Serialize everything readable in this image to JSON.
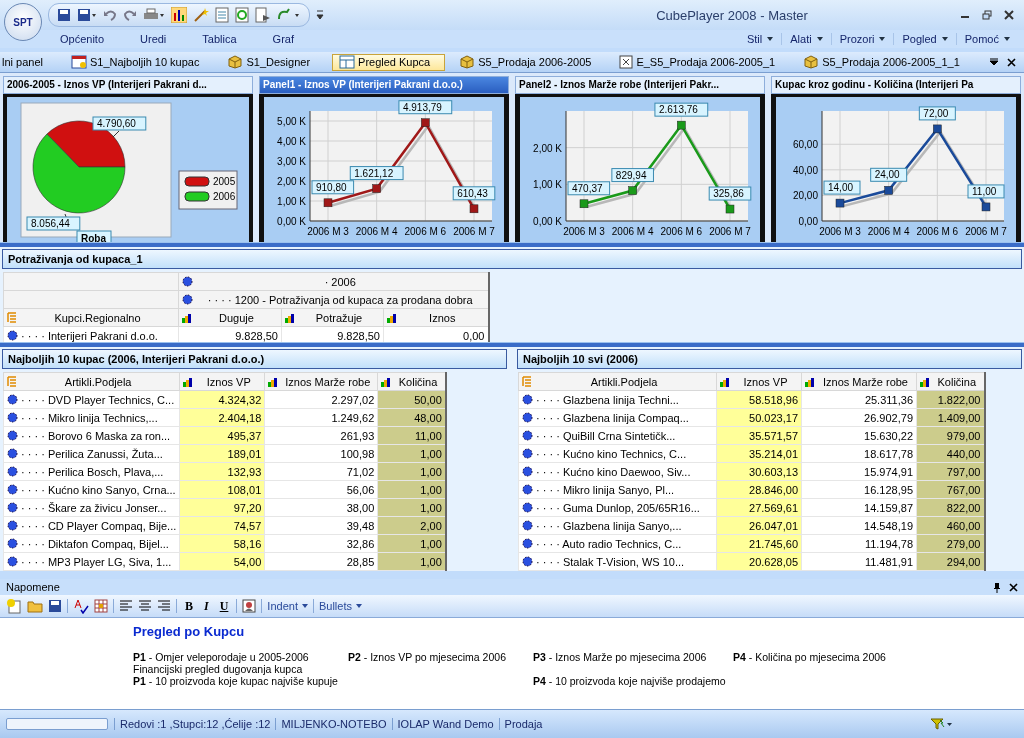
{
  "window": {
    "title": "CubePlayer 2008 - Master",
    "logo": "SPT"
  },
  "menu_left": [
    "Općenito",
    "Uredi",
    "Tablica",
    "Graf"
  ],
  "menu_right": [
    "Stil",
    "Alati",
    "Prozori",
    "Pogled",
    "Pomoć"
  ],
  "tabs": [
    {
      "label": "lni panel",
      "kind": "plain",
      "selected": false
    },
    {
      "label": "S1_Najboljih 10 kupac",
      "kind": "report",
      "selected": false
    },
    {
      "label": "S1_Designer",
      "kind": "cube",
      "selected": false
    },
    {
      "label": "Pregled Kupca",
      "kind": "layout",
      "selected": true
    },
    {
      "label": "S5_Prodaja 2006-2005",
      "kind": "cube",
      "selected": false
    },
    {
      "label": "E_S5_Prodaja 2006-2005_1",
      "kind": "script",
      "selected": false
    },
    {
      "label": "S5_Prodaja 2006-2005_1_1",
      "kind": "cube",
      "selected": false
    }
  ],
  "chart_panels": [
    {
      "title": "2006-2005 - Iznos VP (Interijeri Pakrani d...",
      "selected": false,
      "chart_data": {
        "type": "pie",
        "title": "Roba",
        "categories": [
          "2005",
          "2006"
        ],
        "values": [
          4790.6,
          8056.44
        ],
        "legend": true,
        "value_labels": [
          "4.790,60",
          "8.056,44"
        ]
      }
    },
    {
      "title": "Panel1 - Iznos VP (Interijeri Pakrani d.o.o.)",
      "selected": true,
      "chart_data": {
        "type": "line",
        "categories": [
          "2006 M 3",
          "2006 M 4",
          "2006 M 6",
          "2006 M 7"
        ],
        "grid": true,
        "series": [
          {
            "color": "#a01818",
            "marker": "square",
            "values": [
              911,
              1621,
              4914,
              610
            ]
          }
        ],
        "ylim": [
          0,
          5500
        ],
        "yticks": [
          {
            "value": 0,
            "label": "0,00 K"
          },
          {
            "value": 1000,
            "label": "1,00 K"
          },
          {
            "value": 2000,
            "label": "2,00 K"
          },
          {
            "value": 3000,
            "label": "3,00 K"
          },
          {
            "value": 4000,
            "label": "4,00 K"
          },
          {
            "value": 5000,
            "label": "5,00 K"
          }
        ],
        "value_labels": [
          "910,80",
          "1.621,12",
          "4.913,79",
          "610,43"
        ]
      }
    },
    {
      "title": "Panel2 - Iznos Marže robe (Interijeri Pakr...",
      "selected": false,
      "chart_data": {
        "type": "line",
        "categories": [
          "2006 M 3",
          "2006 M 4",
          "2006 M 6",
          "2006 M 7"
        ],
        "grid": true,
        "series": [
          {
            "color": "#1a9a1a",
            "marker": "square",
            "values": [
              470,
              830,
              2614,
              326
            ]
          }
        ],
        "ylim": [
          0,
          3000
        ],
        "yticks": [
          {
            "value": 0,
            "label": "0,00 K"
          },
          {
            "value": 1000,
            "label": "1,00 K"
          },
          {
            "value": 2000,
            "label": "2,00 K"
          }
        ],
        "value_labels": [
          "470,37",
          "829,94",
          "2.613,76",
          "325,86"
        ]
      }
    },
    {
      "title": "Kupac kroz godinu - Količina (Interijeri Pa",
      "selected": false,
      "chart_data": {
        "type": "line",
        "categories": [
          "2006 M 3",
          "2006 M 4",
          "2006 M 6",
          "2006 M 7"
        ],
        "grid": true,
        "series": [
          {
            "color": "#1a4a9a",
            "marker": "square",
            "values": [
              14,
              24,
              72,
              11
            ]
          }
        ],
        "ylim": [
          0,
          86
        ],
        "yticks": [
          {
            "value": 0,
            "label": "0,00"
          },
          {
            "value": 20,
            "label": "20,00"
          },
          {
            "value": 40,
            "label": "40,00"
          },
          {
            "value": 60,
            "label": "60,00"
          }
        ],
        "value_labels": [
          "14,00",
          "24,00",
          "72,00",
          "11,00"
        ]
      }
    }
  ],
  "receivables": {
    "title": "Potraživanja od kupaca_1",
    "column_levels": [
      "· 2006",
      "· · · · 1200 - Potraživanja od kupaca za prodana dobra"
    ],
    "row_header": "Kupci.Regionalno",
    "columns": [
      "Duguje",
      "Potražuje",
      "Iznos"
    ],
    "rows": [
      {
        "label": "· · · · Interijeri Pakrani d.o.o.",
        "cells": [
          "9.828,50",
          "9.828,50",
          "0,00"
        ]
      }
    ]
  },
  "tables": [
    {
      "title": "Najboljih 10 kupac (2006, Interijeri Pakrani d.o.o.)",
      "row_header": "Artikli.Podjela",
      "columns": [
        {
          "label": "Iznos VP",
          "color": "#ffff99"
        },
        {
          "label": "Iznos Marže robe",
          "color": "#ffffff"
        },
        {
          "label": "Količina",
          "color": "#cccc8c"
        }
      ],
      "rows": [
        {
          "label": "· · · · DVD Player Technics, C...",
          "cells": [
            "4.324,32",
            "2.297,02",
            "50,00"
          ]
        },
        {
          "label": "· · · · Mikro linija Technics,...",
          "cells": [
            "2.404,18",
            "1.249,62",
            "48,00"
          ]
        },
        {
          "label": "· · · ·  Borovo 6 Maska za ron...",
          "cells": [
            "495,37",
            "261,93",
            "11,00"
          ]
        },
        {
          "label": "· · · · Perilica Zanussi, Žuta...",
          "cells": [
            "189,01",
            "100,98",
            "1,00"
          ]
        },
        {
          "label": "· · · · Perilica Bosch, Plava,...",
          "cells": [
            "132,93",
            "71,02",
            "1,00"
          ]
        },
        {
          "label": "· · · · Kućno kino Sanyo, Crna...",
          "cells": [
            "108,01",
            "56,06",
            "1,00"
          ]
        },
        {
          "label": "· · · · Škare za živicu Jonser...",
          "cells": [
            "97,20",
            "38,00",
            "1,00"
          ]
        },
        {
          "label": "· · · · CD Player Compaq, Bije...",
          "cells": [
            "74,57",
            "39,48",
            "2,00"
          ]
        },
        {
          "label": "· · · · Diktafon Compaq, Bijel...",
          "cells": [
            "58,16",
            "32,86",
            "1,00"
          ]
        },
        {
          "label": "· · · · MP3 Player LG, Siva, 1...",
          "cells": [
            "54,00",
            "28,85",
            "1,00"
          ]
        }
      ]
    },
    {
      "title": "Najboljih 10 svi (2006)",
      "row_header": "Artikli.Podjela",
      "columns": [
        {
          "label": "Iznos VP",
          "color": "#ffff99"
        },
        {
          "label": "Iznos Marže robe",
          "color": "#ffffff"
        },
        {
          "label": "Količina",
          "color": "#cccc8c"
        }
      ],
      "rows": [
        {
          "label": "· · · · Glazbena linija Techni...",
          "cells": [
            "58.518,96",
            "25.311,36",
            "1.822,00"
          ]
        },
        {
          "label": "· · · · Glazbena linija Compaq...",
          "cells": [
            "50.023,17",
            "26.902,79",
            "1.409,00"
          ]
        },
        {
          "label": "· · · · QuiBill Crna Sintetičk...",
          "cells": [
            "35.571,57",
            "15.630,22",
            "979,00"
          ]
        },
        {
          "label": "· · · · Kućno kino Technics, C...",
          "cells": [
            "35.214,01",
            "18.617,78",
            "440,00"
          ]
        },
        {
          "label": "· · · · Kućno kino Daewoo, Siv...",
          "cells": [
            "30.603,13",
            "15.974,91",
            "797,00"
          ]
        },
        {
          "label": "· · · · Mikro linija Sanyo, Pl...",
          "cells": [
            "28.846,00",
            "16.128,95",
            "767,00"
          ]
        },
        {
          "label": "· · · · Guma Dunlop, 205/65R16...",
          "cells": [
            "27.569,61",
            "14.159,87",
            "822,00"
          ]
        },
        {
          "label": "· · · · Glazbena linija Sanyo,...",
          "cells": [
            "26.047,01",
            "14.548,19",
            "460,00"
          ]
        },
        {
          "label": "· · · · Auto radio Technics, C...",
          "cells": [
            "21.745,60",
            "11.194,78",
            "279,00"
          ]
        },
        {
          "label": "· · · · Stalak T-Vision, WS 10...",
          "cells": [
            "20.628,05",
            "11.481,91",
            "294,00"
          ]
        }
      ]
    }
  ],
  "notes": {
    "title": "Napomene",
    "format_buttons": [
      "B",
      "I",
      "U"
    ],
    "dropdowns": [
      "Indent",
      "Bullets"
    ],
    "heading": "Pregled po Kupcu",
    "lines": [
      [
        "**P1** - Omjer veleporodaje u 2005-2006",
        "**P2** - Iznos VP po mjesecima 2006",
        "**P3** - Iznos Marže po mjesecima 2006",
        "**P4** - Količina po mjesecima 2006"
      ],
      [
        "Financijski pregled dugovanja kupca"
      ],
      [
        "**P1** - 10 proizvoda koje kupac najviše kupuje",
        "**P4** - 10 proizvoda koje najviše prodajemo"
      ]
    ]
  },
  "progress": {
    "level": 0
  },
  "status_bar": [
    "Redovi :1 ,Stupci:12 ,Ćelije :12",
    "MILJENKO-NOTEBO",
    "IOLAP Wand Demo",
    "Prodaja"
  ]
}
